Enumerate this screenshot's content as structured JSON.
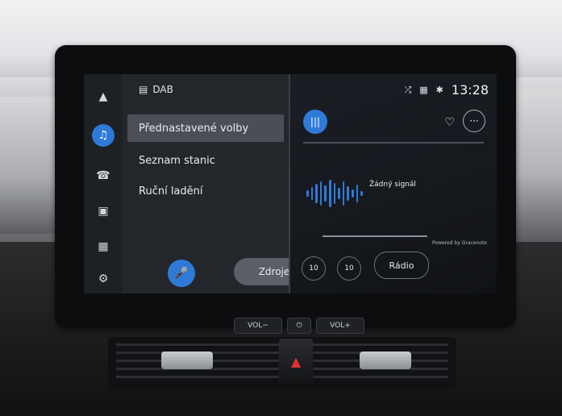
{
  "screen": {
    "source_label": "DAB",
    "time": "13:28",
    "menu": [
      {
        "label": "Přednastavené volby",
        "selected": true
      },
      {
        "label": "Seznam stanic",
        "selected": false
      },
      {
        "label": "Ruční ladění",
        "selected": false
      }
    ],
    "sources_button": "Zdroje",
    "no_signal": "Žádný signál",
    "powered_by": "Powered by Gracenote",
    "skip_back": "10",
    "skip_forward": "10",
    "radio_button": "Rádio",
    "sidebar_icons": [
      "navigation-icon",
      "music-icon",
      "phone-icon",
      "car-icon",
      "apps-icon",
      "settings-icon"
    ],
    "accent_color": "#2f7ad8"
  },
  "hardware": {
    "vol_minus": "VOL−",
    "power": "⏻",
    "vol_plus": "VOL+"
  }
}
